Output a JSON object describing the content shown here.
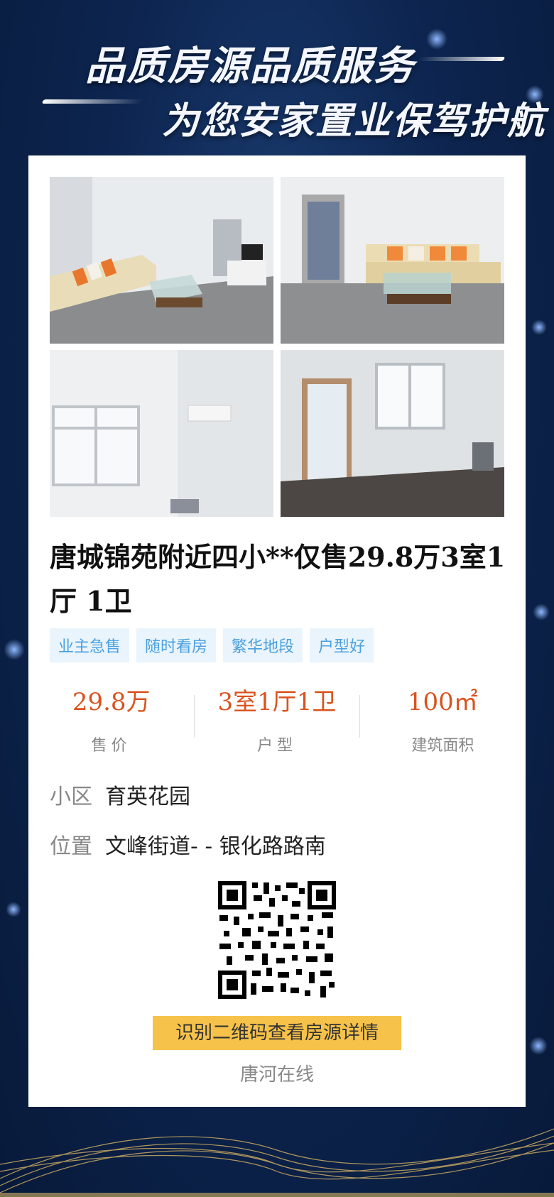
{
  "header": {
    "line1": "品质房源品质服务",
    "line2": "为您安家置业保驾护航"
  },
  "listing": {
    "title": "唐城锦苑附近四小**仅售29.8万3室1厅 1卫",
    "tags": [
      "业主急售",
      "随时看房",
      "繁华地段",
      "户型好"
    ],
    "stats": [
      {
        "value": "29.8万",
        "label": "售价"
      },
      {
        "value": "3室1厅1卫",
        "label": "户型"
      },
      {
        "value": "100㎡",
        "label": "建筑面积"
      }
    ],
    "community_label": "小区",
    "community": "育英花园",
    "location_label": "位置",
    "location": "文峰街道- - 银化路路南"
  },
  "qr": {
    "cta": "识别二维码查看房源详情",
    "brand": "唐河在线"
  },
  "colors": {
    "accent_price": "#d9531e",
    "tag_text": "#4aa0e0",
    "tag_bg": "#eaf4fc",
    "cta_bg": "#f7c24a",
    "background": "#0d2550"
  },
  "photos": [
    "living-room-sofa-tv",
    "living-room-sofa-doorway",
    "bedroom-window-ac",
    "room-window-door"
  ]
}
